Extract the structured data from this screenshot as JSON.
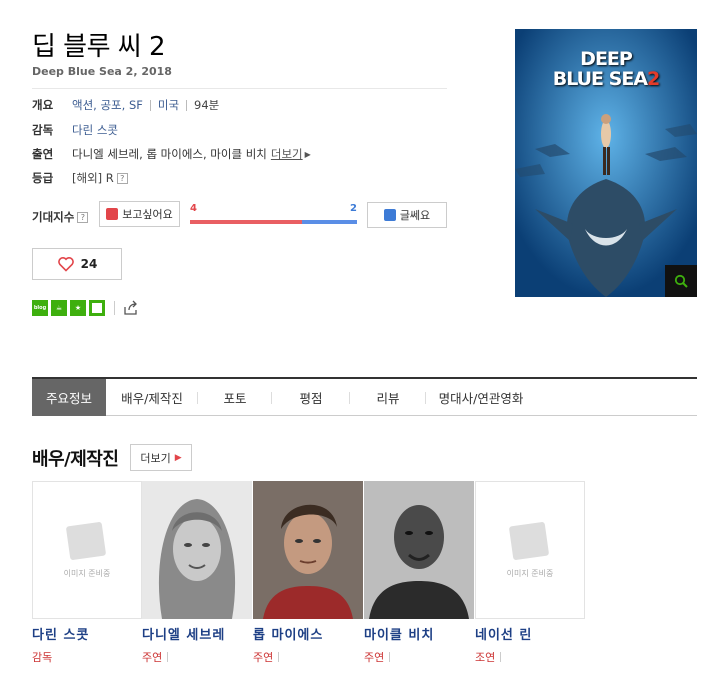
{
  "movie": {
    "title": "딥 블루 씨 2",
    "subtitle": "Deep Blue Sea 2, 2018",
    "overview_label": "개요",
    "genres": "액션, 공포, SF",
    "country": "미국",
    "runtime": "94분",
    "director_label": "감독",
    "director": "다린 스콧",
    "cast_label": "출연",
    "cast_text": "다니엘 세브레, 롭 마이에스, 마이클 비치",
    "cast_more": "더보기",
    "rating_label": "등급",
    "rating": "[해외] R",
    "qmark": "?"
  },
  "expectation": {
    "label": "기대지수",
    "want_label": "보고싶어요",
    "no_label": "글쎄요",
    "want_count": "4",
    "no_count": "2",
    "want_ratio": 0.67
  },
  "like": {
    "count": "24"
  },
  "share": {
    "blog_label": "blog"
  },
  "poster": {
    "title_line1": "DEEP",
    "title_line2": "BLUE SEA",
    "title_num": "2"
  },
  "tabs": [
    {
      "label": "주요정보"
    },
    {
      "label": "배우/제작진"
    },
    {
      "label": "포토"
    },
    {
      "label": "평점"
    },
    {
      "label": "리뷰"
    },
    {
      "label": "명대사/연관영화"
    }
  ],
  "cast_section": {
    "title": "배우/제작진",
    "more_label": "더보기",
    "no_image_text": "이미지 준비중",
    "people": [
      {
        "name": "다린 스콧",
        "role": "감독"
      },
      {
        "name": "다니엘 세브레",
        "role": "주연"
      },
      {
        "name": "롭 마이에스",
        "role": "주연"
      },
      {
        "name": "마이클 비치",
        "role": "주연"
      },
      {
        "name": "네이선 린",
        "role": "조연"
      }
    ]
  },
  "colors": {
    "accent_red": "#e2454a",
    "accent_blue": "#3d7bd6",
    "link": "#1d3f85",
    "green": "#3eaf0e"
  }
}
